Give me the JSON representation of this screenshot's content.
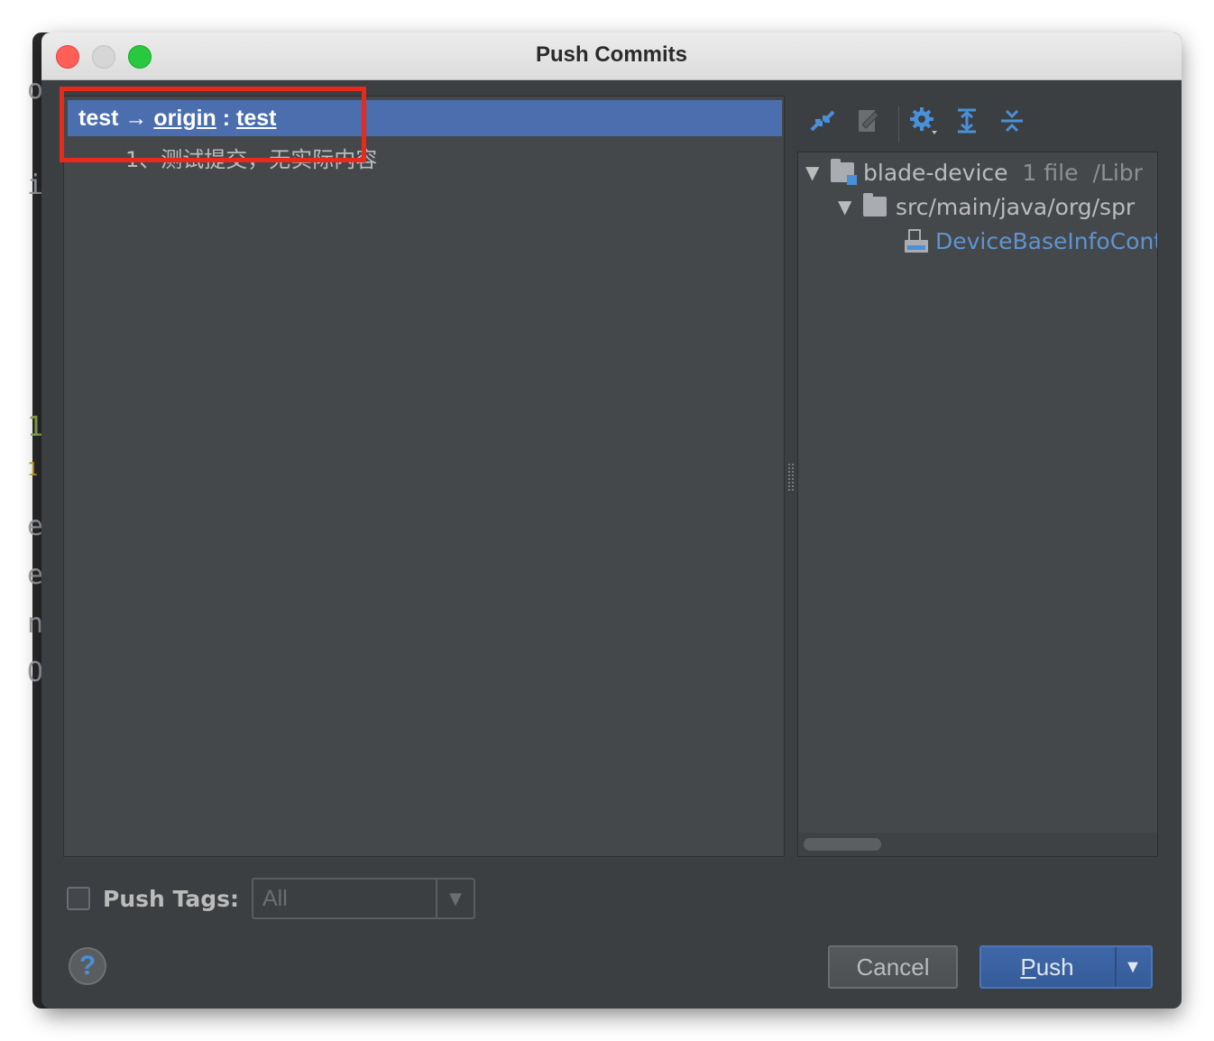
{
  "window": {
    "title": "Push Commits"
  },
  "background_glyphs": [
    "o",
    "i",
    "1",
    "1",
    "e",
    "e",
    "n",
    "O"
  ],
  "left_panel": {
    "branch_row": {
      "source": "test",
      "arrow": "→",
      "remote": "origin",
      "separator": ":",
      "target": "test"
    },
    "commit_message": "1、测试提交，无实际内容"
  },
  "toolbar": {
    "icons": [
      "collapse-changes-icon",
      "show-diff-icon",
      "settings-icon",
      "expand-all-icon",
      "collapse-all-icon"
    ]
  },
  "file_tree": {
    "module": {
      "name": "blade-device",
      "count": "1 file",
      "path": "/Libr"
    },
    "package": {
      "path": "src/main/java/org/spr"
    },
    "file": {
      "name": "DeviceBaseInfoCont"
    }
  },
  "push_tags": {
    "label": "Push Tags:",
    "checked": false,
    "combo_value": "All"
  },
  "buttons": {
    "help": "?",
    "cancel": "Cancel",
    "push_first": "P",
    "push_rest": "ush",
    "push_dropdown": "▼"
  },
  "colors": {
    "selection": "#4b6eaf",
    "highlight_box": "#e8291c",
    "panel_bg": "#45484b",
    "window_bg": "#3c3f41",
    "file_link": "#5f94cf",
    "push_button": "#3f67a8"
  }
}
